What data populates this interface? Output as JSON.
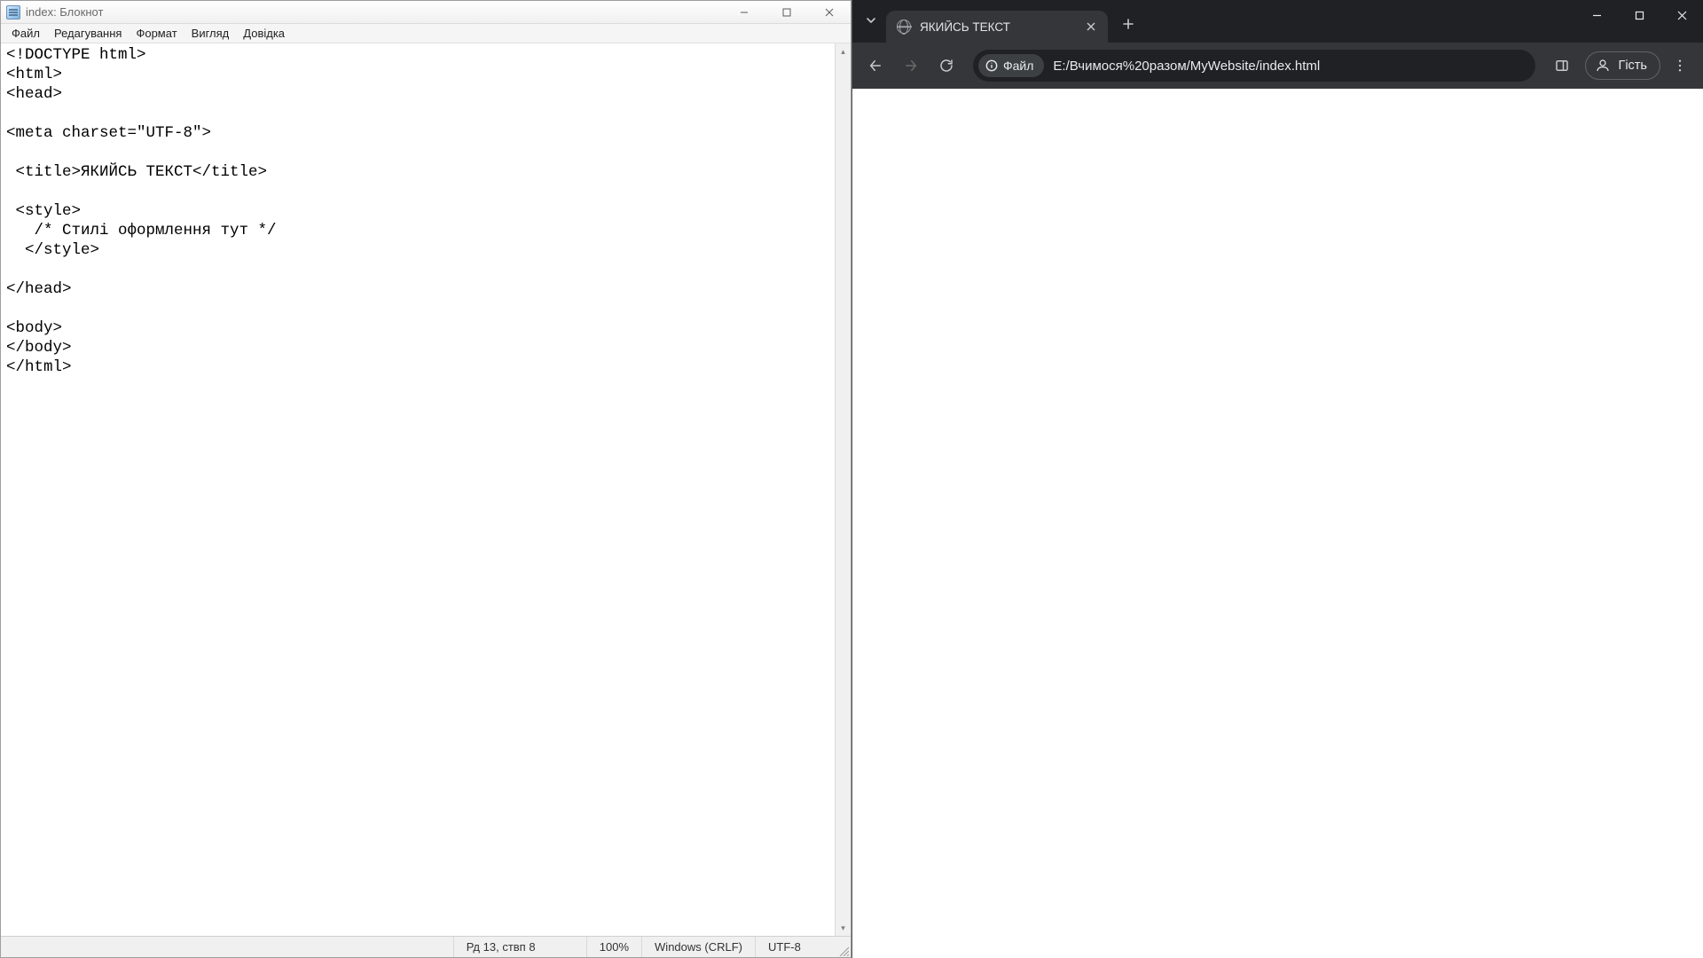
{
  "notepad": {
    "title": "index: Блокнот",
    "menu": {
      "file": "Файл",
      "edit": "Редагування",
      "format": "Формат",
      "view": "Вигляд",
      "help": "Довідка"
    },
    "content": "<!DOCTYPE html>\n<html>\n<head>\n\n<meta charset=\"UTF-8\">\n\n <title>ЯКИЙСЬ ТЕКСТ</title>\n\n <style>\n   /* Стилі оформлення тут */\n  </style>\n\n</head>\n\n<body>\n</body>\n</html>",
    "status": {
      "position": "Рд 13, ствп 8",
      "zoom": "100%",
      "line_ending": "Windows (CRLF)",
      "encoding": "UTF-8"
    }
  },
  "chrome": {
    "tab_title": "ЯКИЙСЬ ТЕКСТ",
    "url_chip_label": "Файл",
    "url": "E:/Вчимося%20разом/MyWebsite/index.html",
    "guest_label": "Гість"
  }
}
